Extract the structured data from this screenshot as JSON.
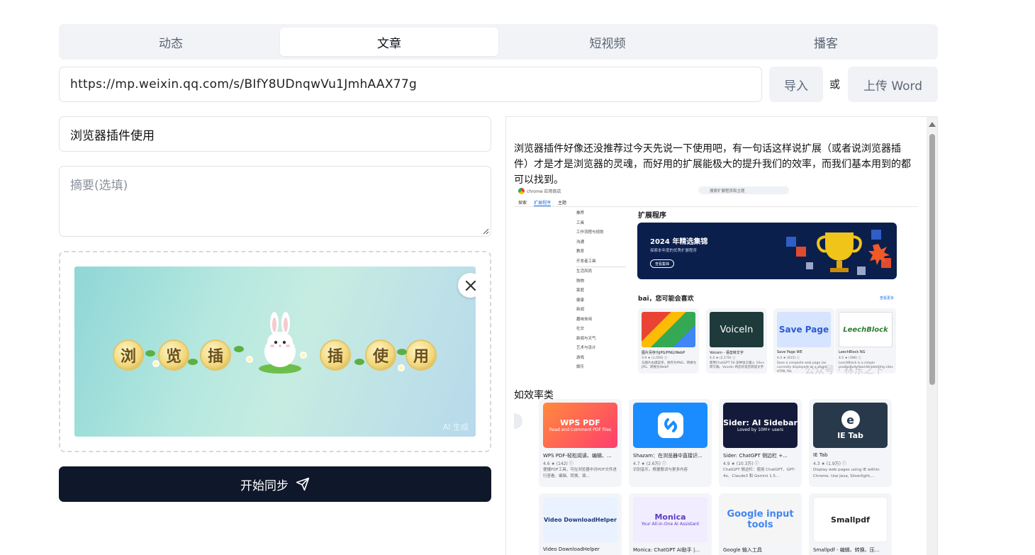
{
  "tabs": [
    {
      "label": "动态"
    },
    {
      "label": "文章"
    },
    {
      "label": "短视频"
    },
    {
      "label": "播客"
    }
  ],
  "url_input": {
    "value": "https://mp.weixin.qq.com/s/BIfY8UDnqwVu1JmhAAX77g"
  },
  "import_button": "导入",
  "or_text": "或",
  "upload_word_button": "上传 Word",
  "title_input": {
    "value": "浏览器插件使用"
  },
  "summary_input": {
    "placeholder": "摘要(选填)"
  },
  "cover": {
    "chars": [
      "浏",
      "览",
      "插",
      "插",
      "使",
      "用"
    ],
    "watermark": "AI 生成"
  },
  "sync_button": "开始同步",
  "preview": {
    "paragraph": "浏览器插件好像还没推荐过今天先说一下使用吧，有一句话这样说扩展（或者说浏览器插件）才是才是浏览器的灵魂，而好用的扩展能极大的提升我们的效率，而我们基本用到的都可以找到。",
    "store_shot": {
      "store_name": "chrome 应用商店",
      "search_placeholder": "搜索扩展程序和主题",
      "nav": [
        "探索",
        "扩展程序",
        "主题"
      ],
      "sidebar": [
        "推荐",
        "工具",
        "工作流程与规划",
        "沟通",
        "教育",
        "开发者工具",
        "",
        "生活风尚",
        "购物",
        "家庭",
        "健康",
        "新闻",
        "趣味休闲",
        "社交",
        "新闻与天气",
        "艺术与设计",
        "游戏",
        "娱乐"
      ],
      "heading": "扩展程序",
      "banner_title": "2024 年精选集锦",
      "banner_sub": "探索本年度的优秀扩展程序",
      "banner_button": "查看集锦",
      "like_heading": "bai，您可能会喜欢",
      "see_more": "查看更多",
      "cards": [
        {
          "title": "图片另存为JPG/PNG/WebP",
          "rating": "3.9 ★ (1,050) ⓘ",
          "desc": "与图片右键菜单，保存为PNG、转换为JPG、转换为WebP"
        },
        {
          "title": "Voicein - 语音转文字",
          "rating": "4.4 ★ (2,170) ⓘ",
          "desc": "使用ChatGPT 50 多种语言输入 10x+ 转写稿。VoiceIn 将您的语音转成文字"
        },
        {
          "title": "Save Page WE",
          "rating": "4.4 ★ (615) ⓘ",
          "desc": "Save a complete web page (as currently displayed) as a single HTML file"
        },
        {
          "title": "LeechBlock NG",
          "rating": "4.5 ★ (396) ⓘ",
          "desc": "LeechBlock is a simple productivity tool for blocking sites"
        }
      ],
      "watermark": "公众号 · 林东之下"
    },
    "label2": "如效率类",
    "grid": [
      {
        "brand": "WPS PDF",
        "sub": "Read and Comment PDF files",
        "title": "WPS PDF-轻松阅读、编辑、...",
        "rating": "4.6 ★ (142) ⓘ",
        "desc": "便捷PDF工具，可在浏览器中对PDF文件进行查看、编辑、转换、填..."
      },
      {
        "brand": "Shazam",
        "sub": "",
        "title": "Shazam：在浏览器中直接识...",
        "rating": "4.7 ★ (2.6万) ⓘ",
        "desc": "识别音乐，根据歌词与更多内容"
      },
      {
        "brand": "Sider: AI Sidebar",
        "sub": "Loved by 10M+ users",
        "title": "Sider: ChatGPT 侧边栏 +...",
        "rating": "4.9 ★ (10.3万) ⓘ",
        "desc": "ChatGPT 侧边栏：使用 ChatGPT、GPT-4o、Claude3 和 Gemini 1.5..."
      },
      {
        "brand": "IE Tab",
        "sub": "",
        "title": "IE Tab",
        "rating": "4.3 ★ (1.9万) ⓘ",
        "desc": "Display web pages using IE within Chrome. Use Java, Silverlight,..."
      },
      {
        "brand": "Video DownloadHelper",
        "sub": "",
        "title": "Video DownloadHelper",
        "rating": "",
        "desc": ""
      },
      {
        "brand": "Monica",
        "sub": "Your All-in-One AI Assistant",
        "title": "Monica: ChatGPT AI助手 |...",
        "rating": "",
        "desc": ""
      },
      {
        "brand": "Google input tools",
        "sub": "",
        "title": "Google 输入工具",
        "rating": "",
        "desc": ""
      },
      {
        "brand": "Smallpdf",
        "sub": "",
        "title": "Smallpdf - 编辑、转换、压...",
        "rating": "",
        "desc": ""
      }
    ]
  },
  "colors": {
    "primary_button": "#0f172a",
    "tab_bg": "#f1f3f7",
    "banner": "#0b1f4d"
  }
}
